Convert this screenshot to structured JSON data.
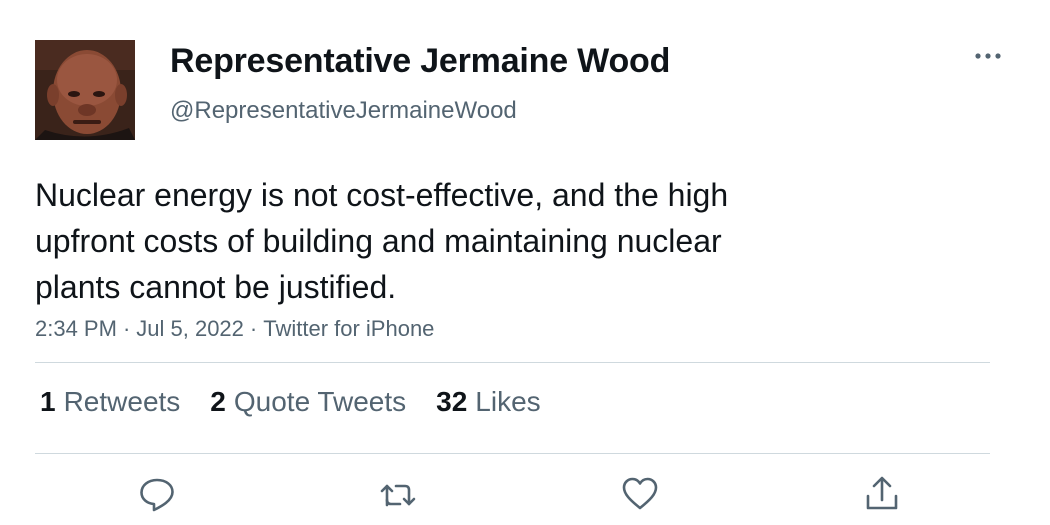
{
  "user": {
    "display_name": "Representative Jermaine Wood",
    "handle": "@RepresentativeJermaineWood",
    "avatar_icon": "profile-photo"
  },
  "tweet": {
    "text": "Nuclear energy is not cost-effective, and the high\nupfront costs of building and maintaining nuclear\nplants cannot be justified.",
    "time": "2:34 PM",
    "date": "Jul 5, 2022",
    "source": "Twitter for iPhone",
    "separator": "·"
  },
  "stats": {
    "retweets_count": "1",
    "retweets_label": "Retweets",
    "quotes_count": "2",
    "quotes_label": "Quote Tweets",
    "likes_count": "32",
    "likes_label": "Likes"
  },
  "actions": {
    "reply_icon": "reply-icon",
    "retweet_icon": "retweet-icon",
    "like_icon": "heart-icon",
    "share_icon": "share-icon",
    "more_icon": "more-icon"
  },
  "colors": {
    "text_primary": "#0f1419",
    "text_secondary": "#536471",
    "divider": "#cfd9de"
  }
}
